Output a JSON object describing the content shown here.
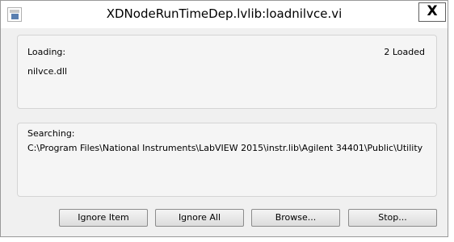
{
  "window": {
    "title": "XDNodeRunTimeDep.lvlib:loadnilvce.vi",
    "close_label": "X"
  },
  "loading": {
    "label": "Loading:",
    "count": "2 Loaded",
    "item": "nilvce.dll"
  },
  "searching": {
    "label": "Searching:",
    "path": "C:\\Program Files\\National Instruments\\LabVIEW 2015\\instr.lib\\Agilent 34401\\Public\\Utility"
  },
  "buttons": {
    "ignore_item": "Ignore Item",
    "ignore_all": "Ignore All",
    "browse": "Browse...",
    "stop": "Stop..."
  }
}
